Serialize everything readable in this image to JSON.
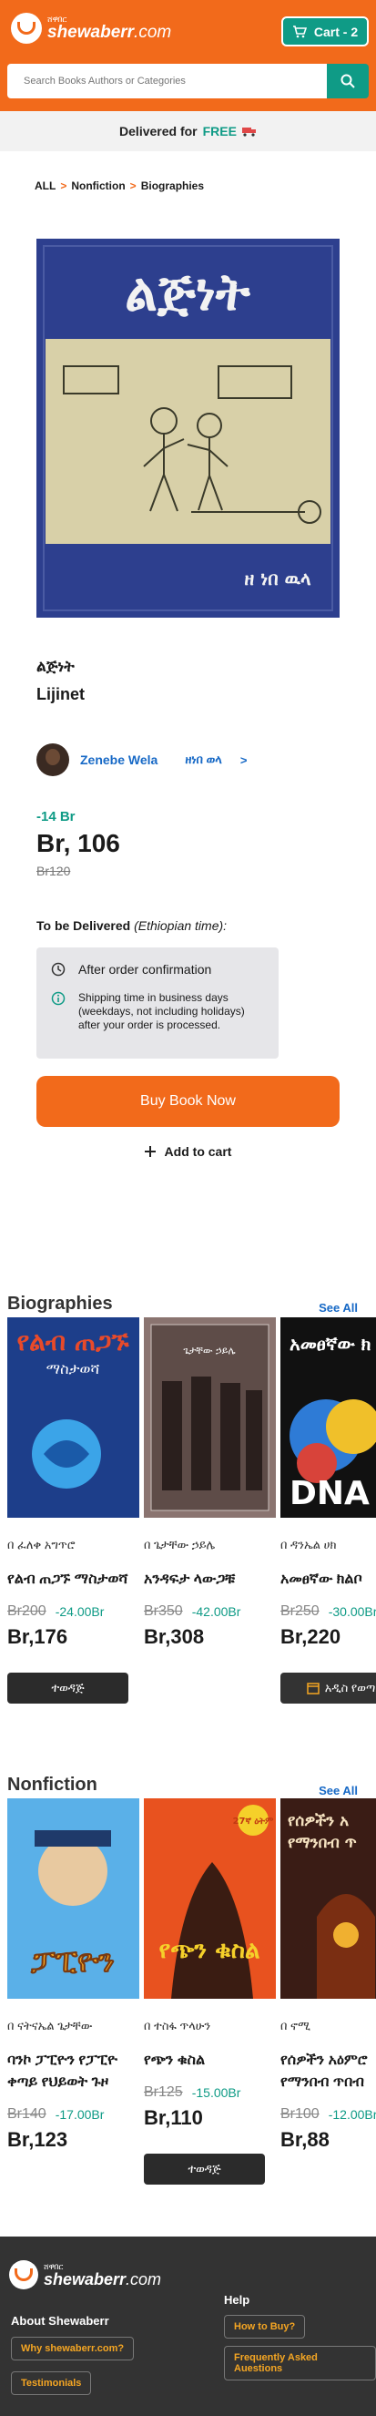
{
  "header": {
    "logo_small": "ሸዋበር",
    "logo_brand": "shewaberr",
    "logo_domain": ".com",
    "cart_label": "Cart - 2",
    "search_placeholder": "Search Books Authors or Categories"
  },
  "delivery_strip": {
    "text": "Delivered for",
    "free": "FREE"
  },
  "breadcrumb": [
    "ALL",
    "Nonfiction",
    "Biographies"
  ],
  "product": {
    "cover_title": "ልጅነት",
    "cover_author": "ዘ ነበ ዉላ",
    "title_amharic": "ልጅነት",
    "title_english": "Lijinet",
    "author_name": "Zenebe Wela",
    "author_amharic": "ዘነበ ወላ",
    "author_arrow": ">",
    "discount": "-14 Br",
    "price": "Br, 106",
    "old_price": "Br120",
    "tbd_label": "To be Delivered",
    "tbd_note": "(Ethiopian time):",
    "delivery_primary": "After order confirmation",
    "delivery_secondary": "Shipping time in business days (weekdays, not including holidays) after your order is processed.",
    "buy_label": "Buy Book Now",
    "add_cart_label": "Add to cart"
  },
  "biographies": {
    "title": "Biographies",
    "see_all": "See All",
    "items": [
      {
        "author": "በ ፈለቀ አግጥሮ",
        "title": "የልብ ጠጋኙ ማስታወሻ",
        "old": "Br200",
        "discount": "-24.00Br",
        "price": "Br,176",
        "button": "ተወዳጅ",
        "cover_text": "የልብ ጠጋኙ",
        "cover_sub": "ማስታወሻ",
        "cover_color": "#1d3e8a"
      },
      {
        "author": "በ ጌታቸው ኃይሌ",
        "title": "አንዳፍታ ላውጋቹ",
        "old": "Br350",
        "discount": "-42.00Br",
        "price": "Br,308",
        "button": "",
        "cover_text": "ጌታቸው ኃይሌ",
        "cover_sub": "",
        "cover_color": "#6d5a52"
      },
      {
        "author": "በ ዳንኤል ሀክ",
        "title": "አመፀኛው ክልቦ",
        "old": "Br250",
        "discount": "-30.00Br",
        "price": "Br,220",
        "button": "አዲስ የወጣ",
        "cover_text": "አመፀኛው ክ",
        "cover_sub": "DNA",
        "cover_color": "#111111"
      }
    ]
  },
  "nonfiction": {
    "title": "Nonfiction",
    "see_all": "See All",
    "items": [
      {
        "author": "በ ናትናኤል ጌታቸው",
        "title": "ባንኮ ፓፒዮን የፓፒዮ",
        "subtitle": "ቀጣይ የህይወት ጉዞ",
        "old": "Br140",
        "discount": "-17.00Br",
        "price": "Br,123",
        "button": "",
        "cover_text": "ፓፒዮን",
        "cover_sub": "",
        "cover_color": "#1f5ea8"
      },
      {
        "author": "በ ተስፋ ጥላሁን",
        "title": "የጭን ቁስል",
        "subtitle": "",
        "old": "Br125",
        "discount": "-15.00Br",
        "price": "Br,110",
        "button": "ተወዳጅ",
        "cover_text": "የጭን ቁስል",
        "cover_sub": "27ኛ ዕትም",
        "cover_color": "#e0461f"
      },
      {
        "author": "በ ኖሚ",
        "title": "የሰዎችን አዕምሮ",
        "subtitle": "የማንበብ ጥበብ",
        "old": "Br100",
        "discount": "-12.00Br",
        "price": "Br,88",
        "button": "",
        "cover_text": "የሰዎችን አ",
        "cover_sub": "የማንበብ ጥ",
        "cover_color": "#3a1c15"
      }
    ]
  },
  "footer": {
    "logo_small": "ሸዋበር",
    "logo_brand": "shewaberr",
    "logo_domain": ".com",
    "about_title": "About Shewaberr",
    "why_link": "Why shewaberr.com?",
    "testimonials_link": "Testimonials",
    "help_title": "Help",
    "how_to_buy": "How to Buy?",
    "faq": "Frequently Asked Auestions"
  },
  "colors": {
    "brand_orange": "#f26a1b",
    "brand_teal": "#0f9b86",
    "link_blue": "#1769c6",
    "footer_bg": "#333333"
  }
}
